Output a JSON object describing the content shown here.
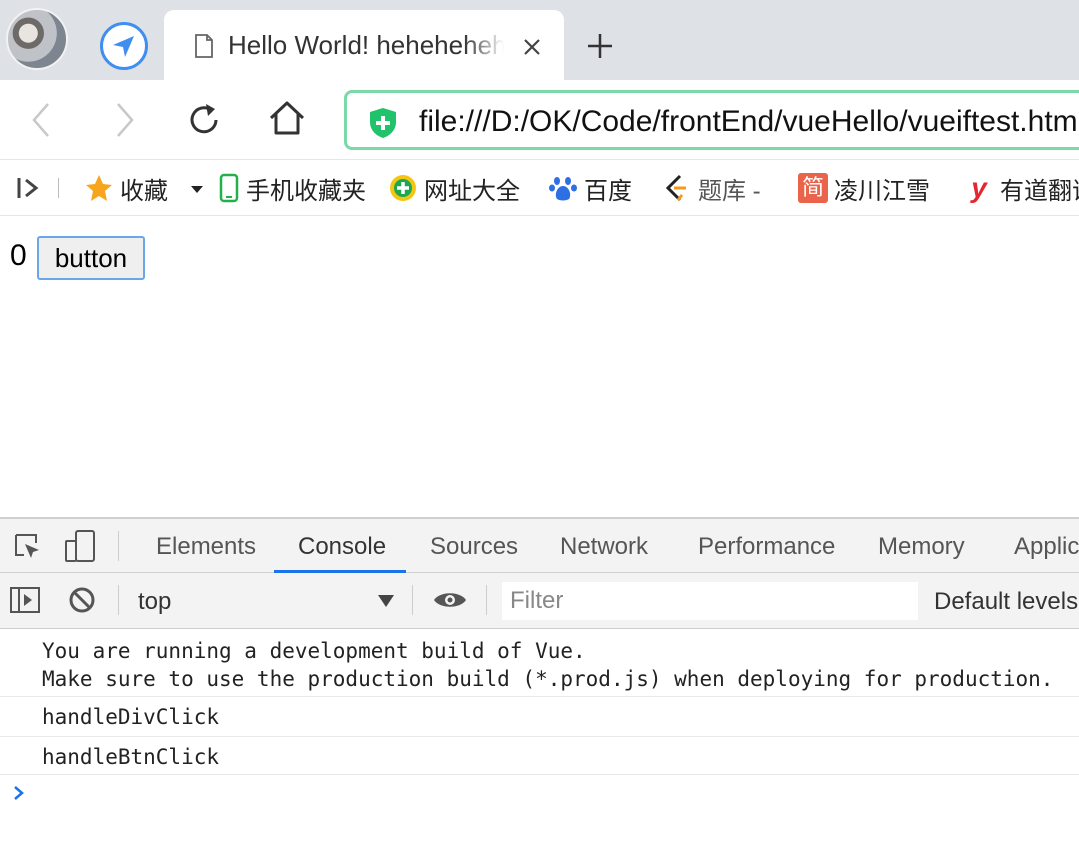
{
  "browser": {
    "tab": {
      "title": "Hello World! hehehehehe"
    },
    "address_bar": {
      "url": "file:///D:/OK/Code/frontEnd/vueHello/vueiftest.html"
    },
    "bookmarks": [
      {
        "label": "收藏",
        "icon": "star-icon"
      },
      {
        "label": "手机收藏夹",
        "icon": "phone-icon"
      },
      {
        "label": "网址大全",
        "icon": "plus-globe-icon"
      },
      {
        "label": "百度",
        "icon": "paw-icon"
      },
      {
        "label": "题库 -",
        "icon": "leetcode-icon"
      },
      {
        "label": "凌川江雪",
        "icon": "jian-icon"
      },
      {
        "label": "有道翻译",
        "icon": "youdao-icon"
      }
    ]
  },
  "page": {
    "counter": "0",
    "button_label": "button"
  },
  "devtools": {
    "tabs": [
      "Elements",
      "Console",
      "Sources",
      "Network",
      "Performance",
      "Memory",
      "Application"
    ],
    "active_tab": "Console",
    "context": "top",
    "filter_placeholder": "Filter",
    "levels": "Default levels",
    "messages": [
      {
        "lines": [
          "You are running a development build of Vue.",
          "Make sure to use the production build (*.prod.js) when deploying for production."
        ]
      },
      {
        "lines": [
          "handleDivClick"
        ]
      },
      {
        "lines": [
          "handleBtnClick"
        ]
      }
    ]
  },
  "colors": {
    "accent": "#1a73e8",
    "omnibox_border": "#7bd8a9",
    "tabstrip": "#dee1e6"
  }
}
